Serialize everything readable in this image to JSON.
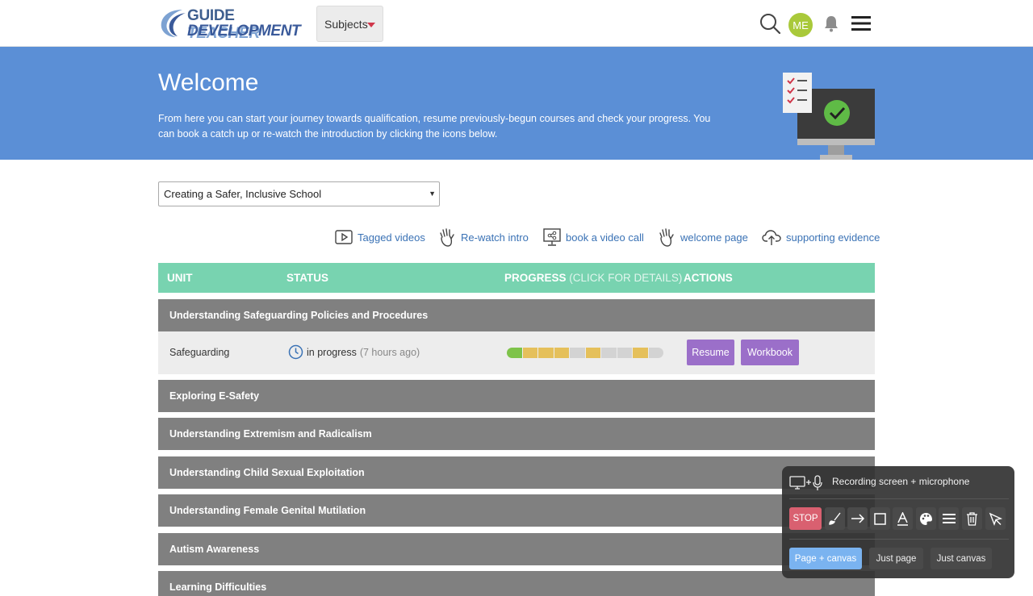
{
  "header": {
    "logo_line1a": "GUIDE",
    "logo_line1b": "TEACHER",
    "logo_line2": "DEVELOPMENT",
    "subjects_label": "Subjects",
    "avatar_initials": "ME"
  },
  "hero": {
    "title": "Welcome",
    "text": "From here you can start your journey towards qualification, resume previously-begun courses and check your progress. You can book a catch up or re-watch the introduction by clicking the icons below."
  },
  "course_select": {
    "value": "Creating a Safer, Inclusive School"
  },
  "links": {
    "tagged_videos": "Tagged videos",
    "rewatch_intro": "Re-watch intro",
    "book_call": "book a video call",
    "welcome_page": "welcome page",
    "supporting_evidence": "supporting evidence"
  },
  "table": {
    "col_unit": "UNIT",
    "col_status": "STATUS",
    "col_progress": "PROGRESS",
    "col_progress_hint": "(CLICK FOR DETAILS)",
    "col_actions": "ACTIONS",
    "units": [
      "Understanding Safeguarding Policies and Procedures",
      "Exploring E-Safety",
      "Understanding Extremism and Radicalism",
      "Understanding Child Sexual Exploitation",
      "Understanding Female Genital Mutilation",
      "Autism Awareness",
      "Learning Difficulties"
    ],
    "expanded_row": {
      "name": "Safeguarding",
      "status": "in progress",
      "status_time": "(7 hours ago)",
      "progress_segments": [
        "complete",
        "started",
        "started",
        "started",
        "not-started",
        "started",
        "not-started",
        "not-started",
        "started",
        "not-started"
      ],
      "resume_label": "Resume",
      "workbook_label": "Workbook"
    }
  },
  "colors": {
    "hero_bg": "#5b8fd6",
    "table_header": "#78d3b0",
    "unit_header": "#808080",
    "action_purple": "#9b6fc9",
    "seg_complete": "#7ec34a",
    "seg_started": "#e5c05b",
    "seg_not_started": "#d3d3d3"
  },
  "recorder": {
    "title": "Recording screen + microphone",
    "stop_label": "STOP",
    "tools": [
      "brush-icon",
      "arrow-icon",
      "rectangle-icon",
      "text-icon",
      "palette-icon",
      "line-width-icon",
      "trash-icon",
      "pointer-icon"
    ],
    "modes": [
      "Page + canvas",
      "Just page",
      "Just canvas"
    ],
    "active_mode": "Page + canvas"
  }
}
